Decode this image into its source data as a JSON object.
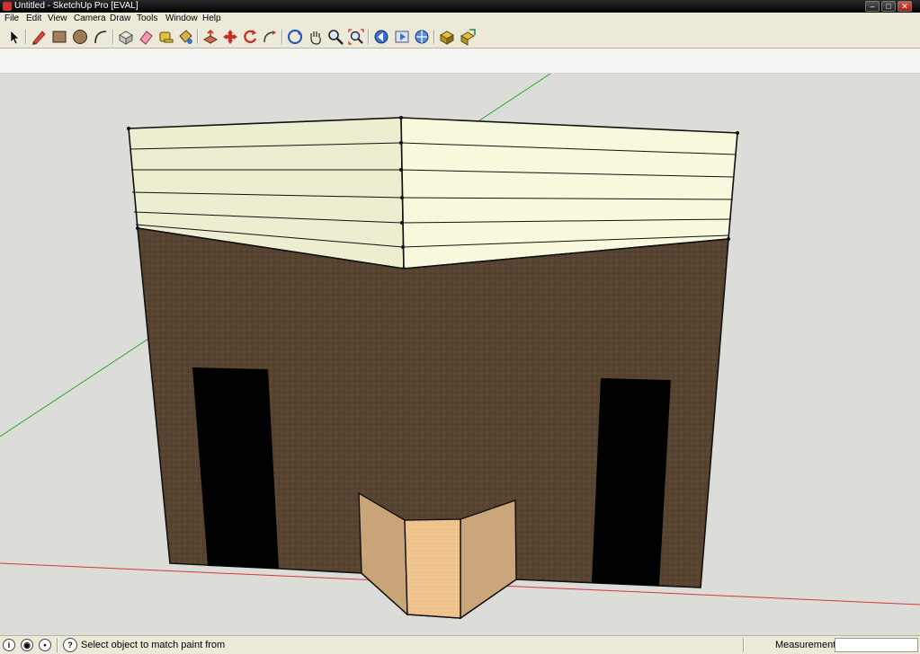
{
  "window": {
    "title": "Untitled - SketchUp Pro [EVAL]",
    "controls": [
      "minimize-icon",
      "maximize-icon",
      "close-icon"
    ]
  },
  "menu": {
    "items": [
      "File",
      "Edit",
      "View",
      "Camera",
      "Draw",
      "Tools",
      "Window",
      "Help"
    ]
  },
  "toolbar": {
    "tools": [
      "select-arrow-icon",
      "pencil-icon",
      "rectangle-icon",
      "circle-icon",
      "arc-icon",
      "make-component-icon",
      "eraser-icon",
      "tape-measure-icon",
      "paint-bucket-icon",
      "push-pull-icon",
      "move-icon",
      "rotate-icon",
      "follow-me-icon",
      "orbit-icon",
      "pan-icon",
      "zoom-icon",
      "zoom-extents-icon",
      "previous-view-icon",
      "next-view-icon",
      "standard-views-icon",
      "get-models-icon",
      "share-model-icon"
    ]
  },
  "statusbar": {
    "hint": "Select object to match paint from",
    "measurements_label": "Measurements",
    "measurements_value": ""
  },
  "colors": {
    "viewport_bg": "#dcdcd8",
    "wall": "#574430",
    "roof_left": "#ededd0",
    "roof_right": "#f8f8dd",
    "doorway": "#000000",
    "porch_side": "#c9a478",
    "porch_front": "#f0c48e",
    "axis_green": "#2fa82f",
    "axis_red": "#d23a3a"
  }
}
